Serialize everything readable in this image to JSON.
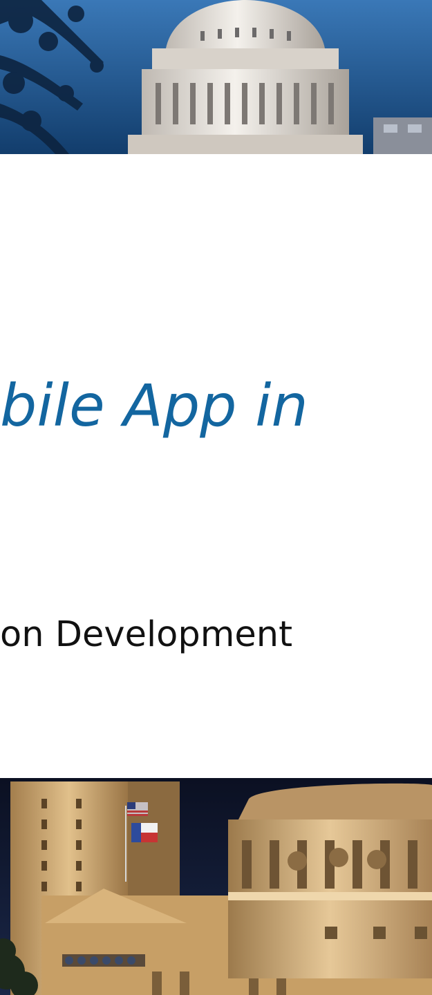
{
  "slide": {
    "title": "bile App in",
    "subtitle": "on Development"
  },
  "images": {
    "top": {
      "name": "capitol-dome-daytime-photo",
      "sky_color": "#1f5f9a",
      "dome_color": "#e7e2da"
    },
    "bottom": {
      "name": "capitol-night-photo",
      "sky_color": "#0c1328",
      "building_color": "#d6b27a"
    }
  },
  "colors": {
    "title_color": "#1366a0",
    "text_color": "#111111",
    "background": "#ffffff"
  }
}
